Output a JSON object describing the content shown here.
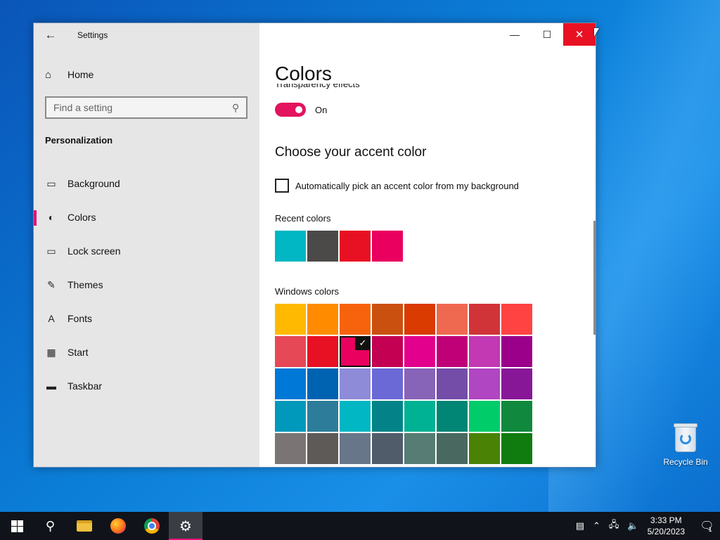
{
  "window": {
    "app_title": "Settings",
    "back_icon": "back-arrow-icon",
    "controls": {
      "minimize": "—",
      "maximize": "☐",
      "close": "✕"
    }
  },
  "sidebar": {
    "home_label": "Home",
    "search": {
      "placeholder": "Find a setting"
    },
    "section": "Personalization",
    "items": [
      {
        "label": "Background",
        "icon": "picture-icon",
        "glyph": "▭",
        "active": false
      },
      {
        "label": "Colors",
        "icon": "palette-icon",
        "glyph": "◐",
        "active": true
      },
      {
        "label": "Lock screen",
        "icon": "lock-screen-icon",
        "glyph": "▭",
        "active": false
      },
      {
        "label": "Themes",
        "icon": "themes-icon",
        "glyph": "✎",
        "active": false
      },
      {
        "label": "Fonts",
        "icon": "fonts-icon",
        "glyph": "A",
        "active": false
      },
      {
        "label": "Start",
        "icon": "start-icon",
        "glyph": "▦",
        "active": false
      },
      {
        "label": "Taskbar",
        "icon": "taskbar-icon",
        "glyph": "▬",
        "active": false
      }
    ]
  },
  "content": {
    "page_title": "Colors",
    "transparency_label": "Transparency effects",
    "transparency_state": "On",
    "accent_heading": "Choose your accent color",
    "auto_pick_label": "Automatically pick an accent color from my background",
    "recent_label": "Recent colors",
    "recent_colors": [
      "#00b7c3",
      "#4c4a48",
      "#e81123",
      "#ea005e"
    ],
    "windows_label": "Windows colors",
    "windows_colors": [
      "#ffb900",
      "#ff8c00",
      "#f7630c",
      "#ca5010",
      "#da3b01",
      "#ef6950",
      "#d13438",
      "#ff4343",
      "#e74856",
      "#e81123",
      "#ea005e",
      "#c30052",
      "#e3008c",
      "#bf0077",
      "#c239b3",
      "#9a0089",
      "#0078d7",
      "#0063b1",
      "#8e8cd8",
      "#6b69d6",
      "#8764b8",
      "#744da9",
      "#b146c2",
      "#881798",
      "#0099bc",
      "#2d7d9a",
      "#00b7c3",
      "#038387",
      "#00b294",
      "#018574",
      "#00cc6a",
      "#10893e",
      "#7a7574",
      "#5d5a58",
      "#68768a",
      "#515c6b",
      "#567c73",
      "#486860",
      "#498205",
      "#107c10"
    ],
    "selected_color_index": 10
  },
  "desktop": {
    "recycle_bin_label": "Recycle Bin"
  },
  "taskbar": {
    "time": "3:33 PM",
    "date": "5/20/2023",
    "notification_count": "1"
  }
}
